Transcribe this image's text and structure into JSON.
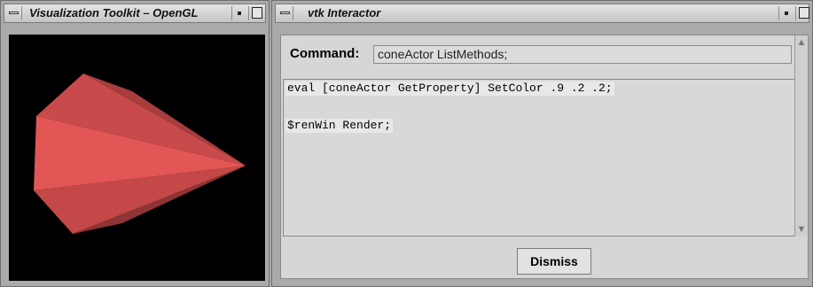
{
  "vtk_window": {
    "title": "Visualization Toolkit – OpenGL"
  },
  "interactor_window": {
    "title": "vtk Interactor",
    "command_label": "Command:",
    "command_value": "coneActor ListMethods;",
    "output_lines": [
      "eval [coneActor GetProperty] SetColor .9 .2 .2;",
      "$renWin Render;"
    ],
    "dismiss_label": "Dismiss"
  },
  "colors": {
    "viewport_background": "#000000",
    "cone_base": "#e35656"
  }
}
